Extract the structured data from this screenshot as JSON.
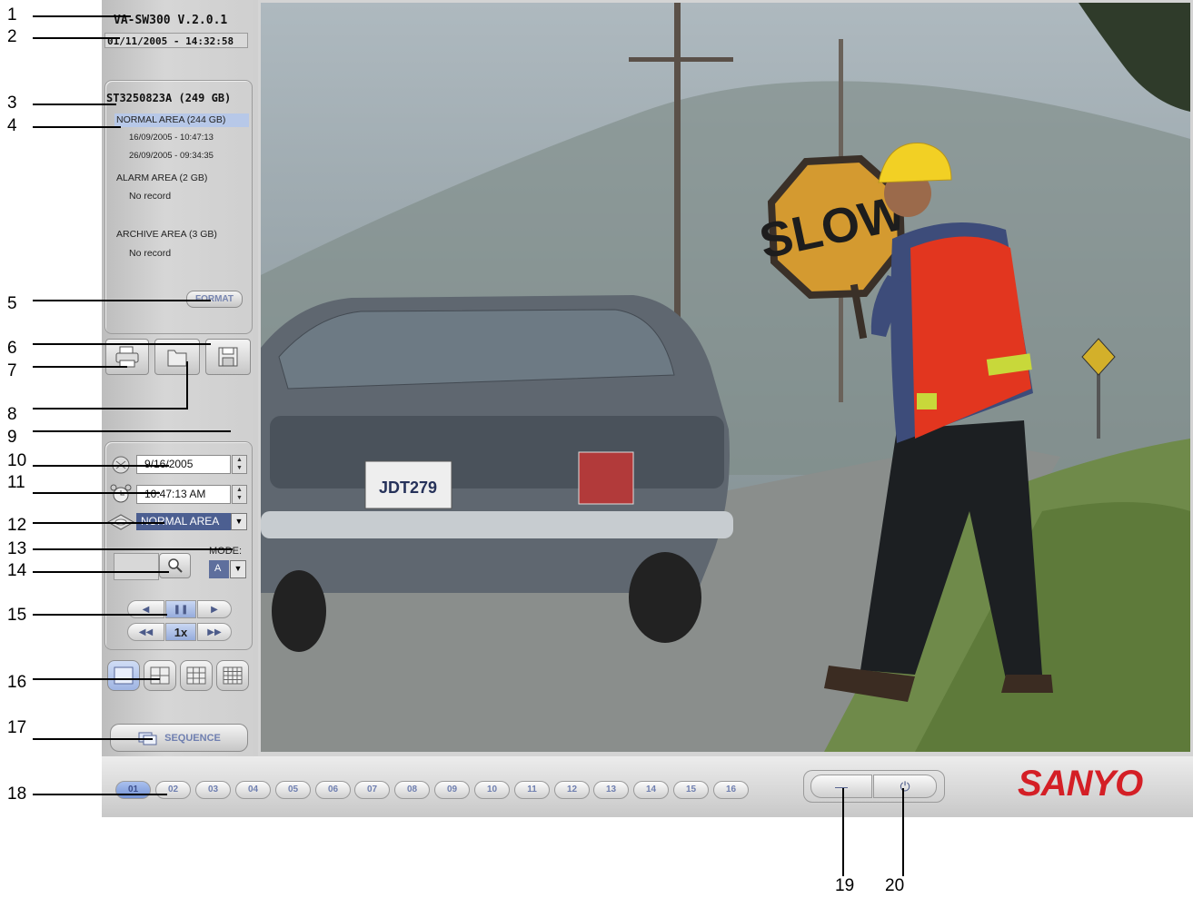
{
  "app": {
    "title": "VA-SW300  V.2.0.1",
    "datetime": "01/11/2005 - 14:32:58"
  },
  "disk": {
    "name": "ST3250823A (249 GB)",
    "areas": [
      {
        "label": "NORMAL AREA (244 GB)",
        "lines": [
          "16/09/2005 - 10:47:13",
          "26/09/2005 - 09:34:35"
        ],
        "selected": true
      },
      {
        "label": "ALARM AREA (2 GB)",
        "lines": [
          "No record"
        ],
        "selected": false
      },
      {
        "label": "ARCHIVE AREA (3 GB)",
        "lines": [
          "No record"
        ],
        "selected": false
      }
    ],
    "format_label": "FORMAT"
  },
  "search": {
    "date_value": "9/16/2005",
    "time_value": "10:47:13 AM",
    "area_value": "NORMAL AREA",
    "mode_label": "MODE:",
    "mode_value": "A",
    "speed_label": "1x"
  },
  "controls": {
    "sequence_label": "SEQUENCE"
  },
  "video": {
    "sign_text": "SLOW",
    "plate_text": "JDT279"
  },
  "channels": [
    "01",
    "02",
    "03",
    "04",
    "05",
    "06",
    "07",
    "08",
    "09",
    "10",
    "11",
    "12",
    "13",
    "14",
    "15",
    "16"
  ],
  "active_channel": "01",
  "window_controls": {
    "minimize_glyph": "—",
    "power_glyph": "⏻"
  },
  "brand": {
    "logo_text": "SANYO",
    "color": "#d41f26"
  },
  "callouts": [
    "1",
    "2",
    "3",
    "4",
    "5",
    "6",
    "7",
    "8",
    "9",
    "10",
    "11",
    "12",
    "13",
    "14",
    "15",
    "16",
    "17",
    "18",
    "19",
    "20"
  ],
  "colors": {
    "selection": "#b7c8e8",
    "dropdown": "#4c5f91",
    "channel_text": "#6f7fb0"
  }
}
